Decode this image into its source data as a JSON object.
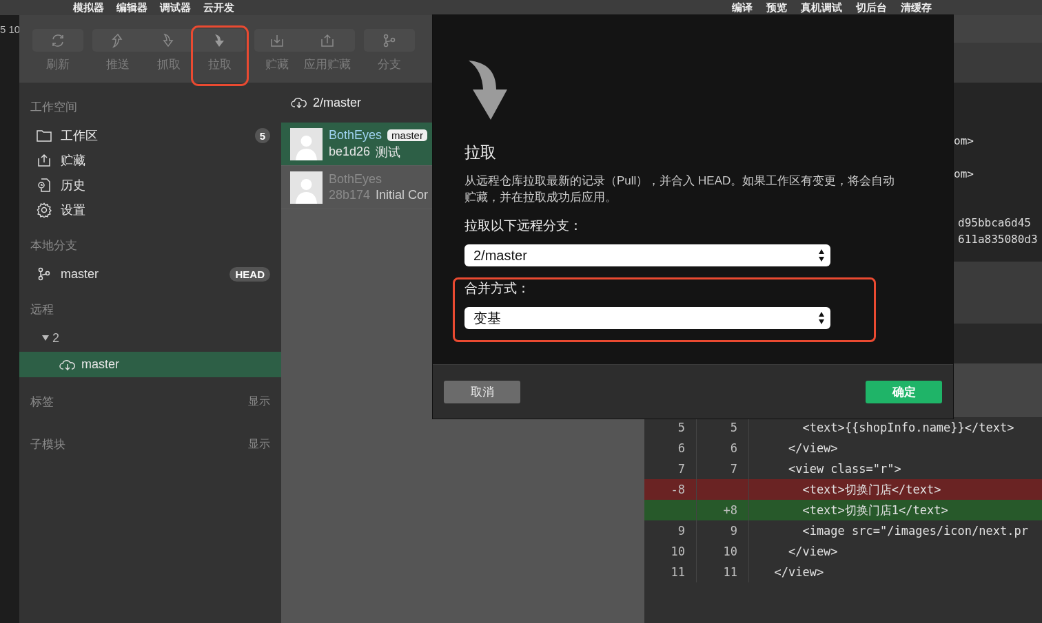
{
  "menu_bar": {
    "left": [
      "模拟器",
      "编辑器",
      "调试器",
      "云开发"
    ],
    "right": [
      "编译",
      "预览",
      "真机调试",
      "切后台",
      "清缓存"
    ]
  },
  "edge_text": "5 10",
  "toolbar": {
    "groups": [
      {
        "buttons": [
          {
            "label": "刷新",
            "highlighted": false
          }
        ]
      },
      {
        "buttons": [
          {
            "label": "推送",
            "highlighted": false
          },
          {
            "label": "抓取",
            "highlighted": false
          },
          {
            "label": "拉取",
            "highlighted": true
          }
        ]
      },
      {
        "buttons": [
          {
            "label": "贮藏",
            "highlighted": false
          },
          {
            "label": "应用贮藏",
            "highlighted": false
          }
        ]
      },
      {
        "buttons": [
          {
            "label": "分支",
            "highlighted": false
          }
        ]
      }
    ]
  },
  "sidebar": {
    "workspace": {
      "title": "工作空间",
      "items": [
        {
          "label": "工作区",
          "badge": "5",
          "selected": false
        },
        {
          "label": "贮藏",
          "selected": false
        },
        {
          "label": "历史",
          "selected": false
        },
        {
          "label": "设置",
          "selected": false
        }
      ]
    },
    "local": {
      "title": "本地分支",
      "items": [
        {
          "label": "master",
          "badge": "HEAD",
          "selected": false
        }
      ]
    },
    "remote": {
      "title": "远程",
      "tree": [
        {
          "label": "2",
          "expanded": true,
          "children": [
            {
              "label": "master",
              "selected": true
            }
          ]
        }
      ]
    },
    "extras": [
      {
        "title": "标签",
        "action": "显示"
      },
      {
        "title": "子模块",
        "action": "显示"
      }
    ]
  },
  "commit_list": {
    "branch": "2/master",
    "commits": [
      {
        "author": "BothEyes",
        "tag": "master",
        "hash": "be1d26",
        "message": "测试",
        "selected": true
      },
      {
        "author": "BothEyes",
        "hash": "28b174",
        "message": "Initial Cor",
        "selected": false
      }
    ]
  },
  "commit_detail": {
    "values": [
      "om>",
      "om>",
      "d95bbca6d45",
      "611a835080d3"
    ]
  },
  "diff": {
    "lines": [
      {
        "kind": "context",
        "old": "5",
        "new": "5",
        "code": "      <text>{{shopInfo.name}}</text>"
      },
      {
        "kind": "context",
        "old": "6",
        "new": "6",
        "code": "    </view>"
      },
      {
        "kind": "context",
        "old": "7",
        "new": "7",
        "code": "    <view class=\"r\">"
      },
      {
        "kind": "removed",
        "old": "-8",
        "code": "      <text>切换门店</text>"
      },
      {
        "kind": "added",
        "new": "+8",
        "code": "      <text>切换门店1</text>"
      },
      {
        "kind": "context",
        "old": "9",
        "new": "9",
        "code": "      <image src=\"/images/icon/next.pr"
      },
      {
        "kind": "context",
        "old": "10",
        "new": "10",
        "code": "    </view>"
      },
      {
        "kind": "context",
        "old": "11",
        "new": "11",
        "code": "  </view>"
      }
    ]
  },
  "dialog": {
    "title": "拉取",
    "description": "从远程仓库拉取最新的记录（Pull），并合入 HEAD。如果工作区有变更，将会自动贮藏，并在拉取成功后应用。",
    "fields": [
      {
        "label": "拉取以下远程分支：",
        "value": "2/master",
        "highlighted": false
      },
      {
        "label": "合并方式：",
        "value": "变基",
        "highlighted": true
      }
    ],
    "buttons": [
      {
        "label": "取消",
        "kind": "secondary"
      },
      {
        "label": "确定",
        "kind": "primary"
      }
    ]
  }
}
